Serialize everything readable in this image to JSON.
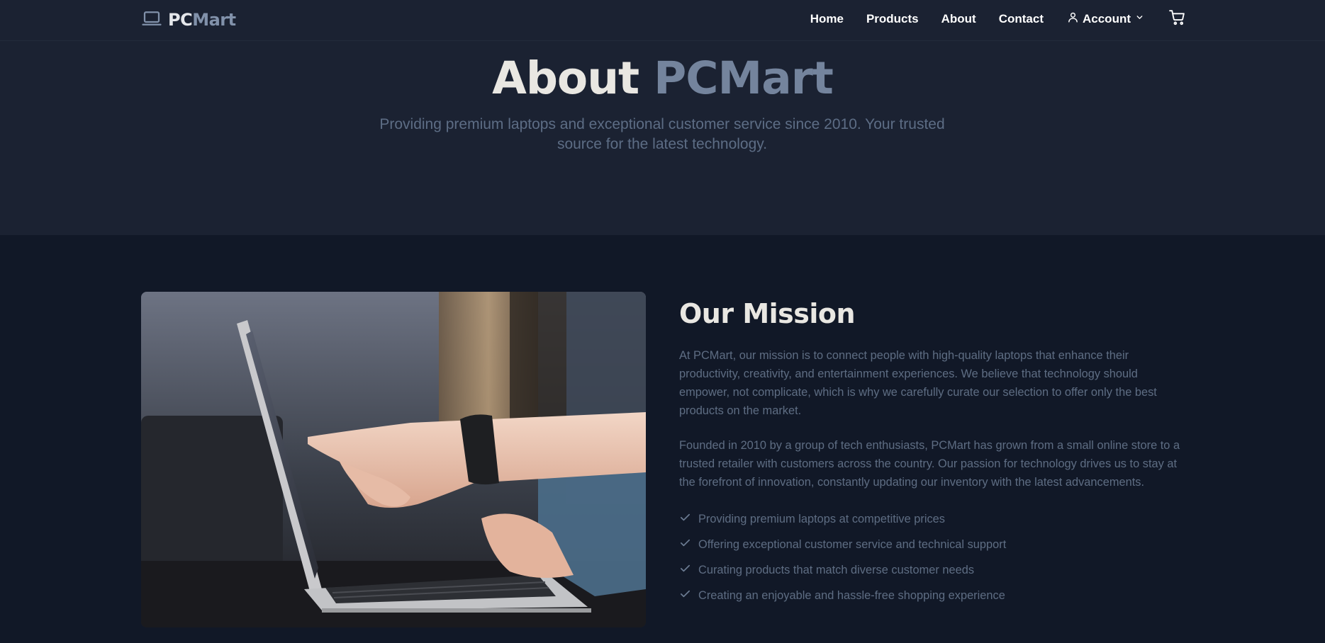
{
  "navbar": {
    "brand_part1": "PC",
    "brand_part2": "Mart",
    "links": [
      "Home",
      "Products",
      "About",
      "Contact"
    ],
    "account_label": "Account"
  },
  "hero": {
    "title_part1": "About",
    "title_part2": "PCMart",
    "subtitle": "Providing premium laptops and exceptional customer service since 2010. Your trusted source for the latest technology."
  },
  "mission": {
    "title": "Our Mission",
    "paragraphs": [
      "At PCMart, our mission is to connect people with high-quality laptops that enhance their productivity, creativity, and entertainment experiences. We believe that technology should empower, not complicate, which is why we carefully curate our selection to offer only the best products on the market.",
      "Founded in 2010 by a group of tech enthusiasts, PCMart has grown from a small online store to a trusted retailer with customers across the country. Our passion for technology drives us to stay at the forefront of innovation, constantly updating our inventory with the latest advancements."
    ],
    "checklist": [
      "Providing premium laptops at competitive prices",
      "Offering exceptional customer service and technical support",
      "Curating products that match diverse customer needs",
      "Creating an enjoyable and hassle-free shopping experience"
    ]
  },
  "icons": {
    "brand": "laptop-icon",
    "account": "user-icon",
    "account_dropdown": "chevron-down-icon",
    "cart": "cart-icon",
    "list_bullet": "check-icon"
  },
  "colors": {
    "page_bg": "#111827",
    "hero_bg": "#1b2232",
    "brand_accent": "#74849d",
    "heading": "#e9e7e2",
    "body_text": "#5e6d83"
  }
}
